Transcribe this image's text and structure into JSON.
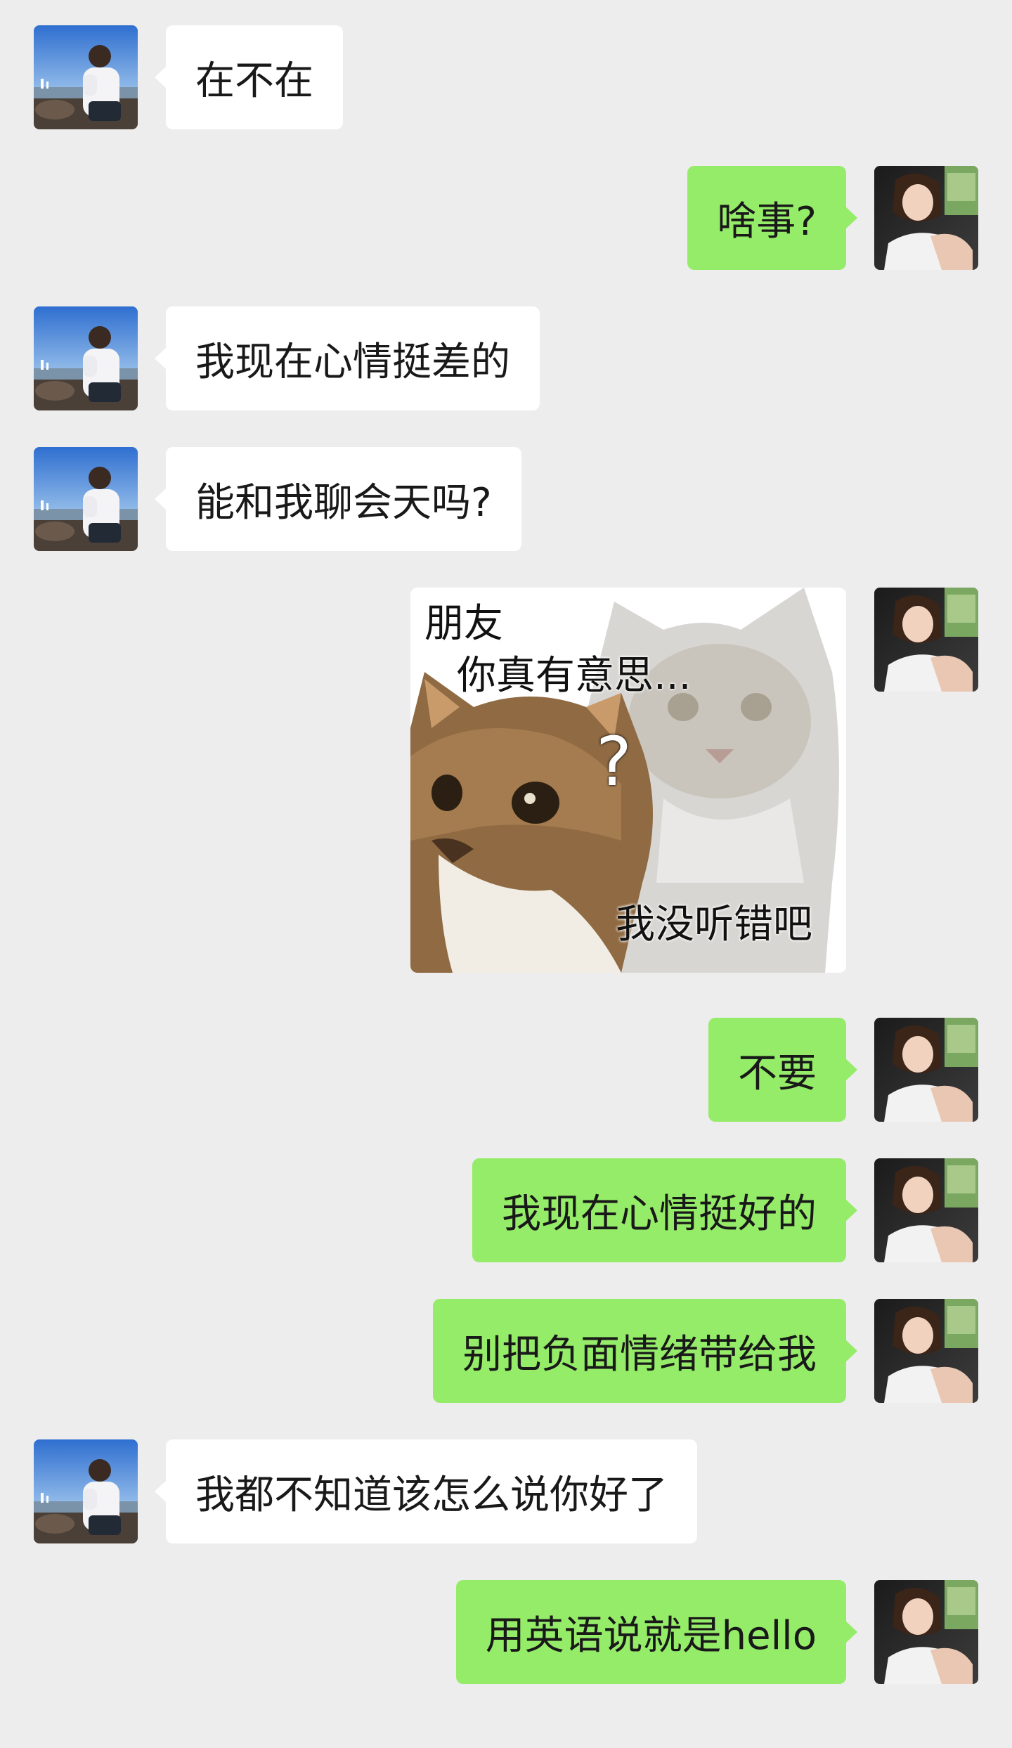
{
  "messages": [
    {
      "from": "friend",
      "text": "在不在"
    },
    {
      "from": "me",
      "text": "啥事?"
    },
    {
      "from": "friend",
      "text": "我现在心情挺差的"
    },
    {
      "from": "friend",
      "text": "能和我聊会天吗?"
    },
    {
      "from": "me",
      "type": "sticker",
      "caption_top": "朋友",
      "caption_mid": "你真有意思...",
      "caption_bottom": "我没听错吧",
      "question_mark": "?"
    },
    {
      "from": "me",
      "text": "不要"
    },
    {
      "from": "me",
      "text": "我现在心情挺好的"
    },
    {
      "from": "me",
      "text": "别把负面情绪带给我"
    },
    {
      "from": "friend",
      "text": "我都不知道该怎么说你好了"
    },
    {
      "from": "me",
      "text": "用英语说就是hello"
    }
  ],
  "colors": {
    "background": "#ededed",
    "incoming_bubble": "#ffffff",
    "outgoing_bubble": "#95ec69",
    "text": "#191919"
  },
  "avatars": {
    "friend": "person-by-sea-avatar",
    "me": "woman-in-car-avatar"
  }
}
